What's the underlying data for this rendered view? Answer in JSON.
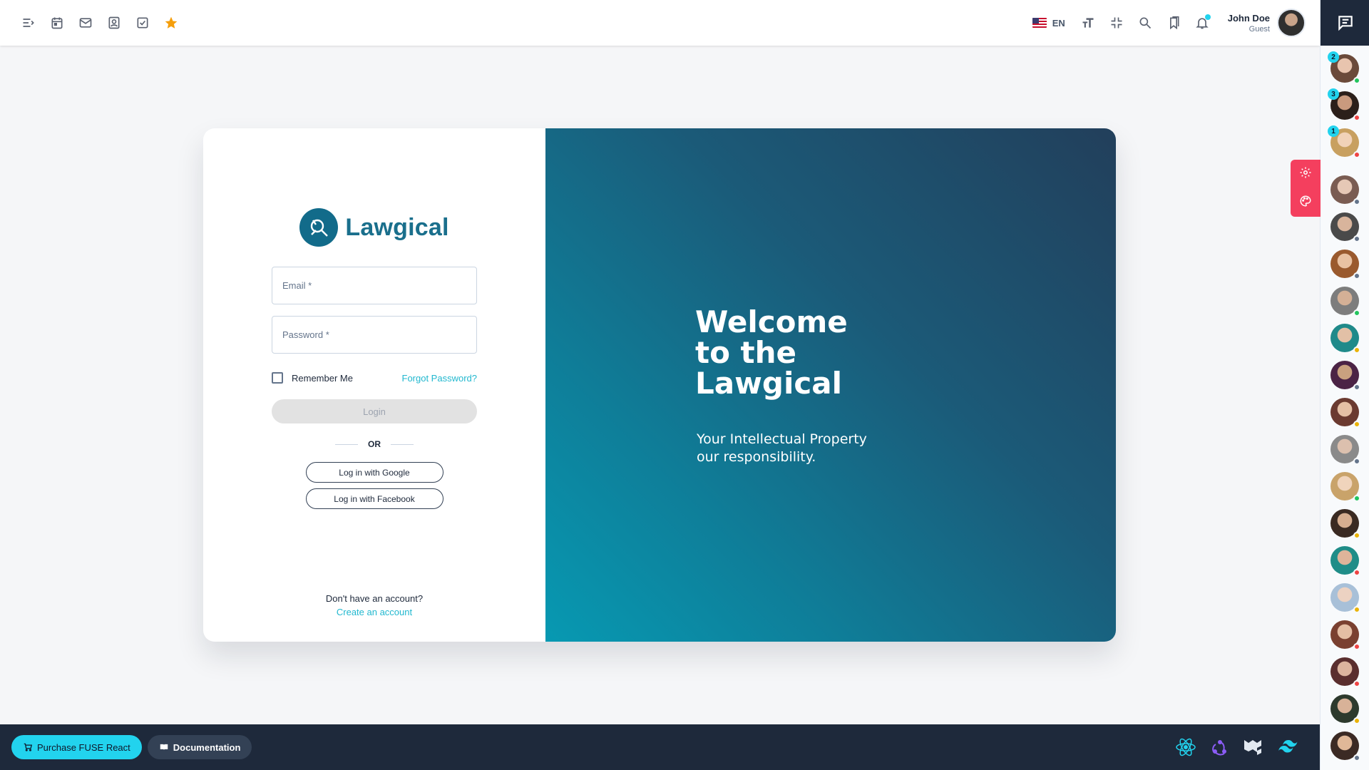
{
  "topbar": {
    "icons": [
      "menu-collapse-icon",
      "calendar-icon",
      "mail-icon",
      "contacts-icon",
      "tasks-icon",
      "star-icon"
    ],
    "language": "EN",
    "right_icons": [
      "font-size-icon",
      "fullscreen-exit-icon",
      "search-icon",
      "bookmark-icon",
      "bell-icon"
    ],
    "user": {
      "name": "John Doe",
      "role": "Guest"
    }
  },
  "login": {
    "brand": "Lawgical",
    "email_placeholder": "Email *",
    "password_placeholder": "Password *",
    "remember_me": "Remember Me",
    "forgot_password": "Forgot Password?",
    "login_button": "Login",
    "or": "OR",
    "google_button": "Log in with Google",
    "facebook_button": "Log in with Facebook",
    "no_account": "Don't have an account?",
    "create_account": "Create an account"
  },
  "hero": {
    "welcome_line1": "Welcome",
    "welcome_line2": "to the",
    "welcome_line3": "Lawgical",
    "tagline_line1": "Your Intellectual Property",
    "tagline_line2": "our responsibility."
  },
  "bottombar": {
    "purchase_label": "Purchase FUSE React",
    "docs_label": "Documentation",
    "tech_icons": [
      "react-icon",
      "redux-icon",
      "mui-icon",
      "tailwind-icon"
    ]
  },
  "chat_rail": {
    "unread_counts": [
      "2",
      "3",
      "1"
    ]
  },
  "colors": {
    "accent": "#22d3ee",
    "brand": "#1a6f8c",
    "hero_gradient_start": "#223f5b",
    "hero_gradient_end": "#0799b2",
    "dark_bar": "#1e293b",
    "float_panel": "#f43f5e"
  }
}
